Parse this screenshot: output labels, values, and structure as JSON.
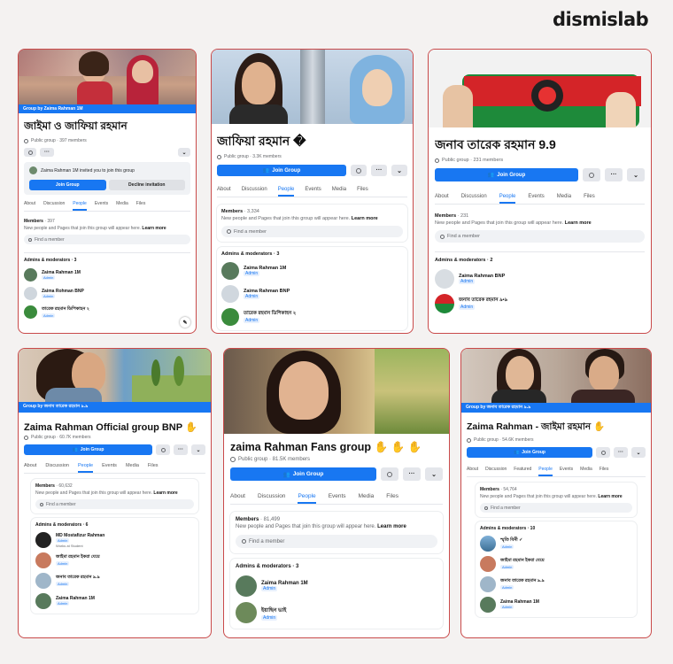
{
  "brand": "dismislab",
  "colors": {
    "accent": "#1877f2",
    "frame": "#c94a4a"
  },
  "cards": [
    {
      "group_by": "Group by Zaima Rahman 1M",
      "title": "জাইমা ও জাফিয়া রহমান",
      "meta": "Public group · 397 members",
      "invite": "Zaima Rahman 1M invited you to join this group",
      "join": "Join Group",
      "decline": "Decline invitation",
      "tabs": [
        "About",
        "Discussion",
        "People",
        "Events",
        "Media",
        "Files"
      ],
      "members_label": "Members",
      "members_count": "· 397",
      "members_note": "New people and Pages that join this group will appear here.",
      "learn_more": "Learn more",
      "search_placeholder": "Find a member",
      "admins_label": "Admins & moderators · 3",
      "admins": [
        {
          "name": "Zaima Rahman 1M",
          "badge": "Admin"
        },
        {
          "name": "Zaima Rohman BNP",
          "badge": "Admin"
        },
        {
          "name": "তারেক রহমান ডিপিকাহন ২",
          "badge": "Admin"
        }
      ]
    },
    {
      "title": "জাফিয়া রহমান �",
      "meta": "Public group · 3.3K members",
      "join": "Join Group",
      "tabs": [
        "About",
        "Discussion",
        "People",
        "Events",
        "Media",
        "Files"
      ],
      "members_label": "Members",
      "members_count": "· 3,334",
      "members_note": "New people and Pages that join this group will appear here.",
      "learn_more": "Learn more",
      "search_placeholder": "Find a member",
      "admins_label": "Admins & moderators · 3",
      "admins": [
        {
          "name": "Zaima Rahman 1M",
          "badge": "Admin"
        },
        {
          "name": "Zaima Rahman BNP",
          "badge": "Admin"
        },
        {
          "name": "তারেক রহমান ডিপিকাহন ২",
          "badge": "Admin"
        }
      ]
    },
    {
      "title": "জনাব তারেক রহমান 9.9",
      "meta": "Public group · 231 members",
      "join": "Join Group",
      "tabs": [
        "About",
        "Discussion",
        "People",
        "Events",
        "Media",
        "Files"
      ],
      "members_label": "Members",
      "members_count": "· 231",
      "members_note": "New people and Pages that join this group will appear here.",
      "learn_more": "Learn more",
      "search_placeholder": "Find a member",
      "admins_label": "Admins & moderators · 2",
      "admins": [
        {
          "name": "Zaima Rahman BNP",
          "badge": "Admin"
        },
        {
          "name": "জনাব তারেক রহমান ৯•৯",
          "badge": "Admin"
        }
      ]
    },
    {
      "group_by": "Group by জনাব তারেক রহমান ৯.৯",
      "title": "Zaima Rahman Official group BNP",
      "meta": "Public group · 60.7K members",
      "join": "Join Group",
      "tabs": [
        "About",
        "Discussion",
        "People",
        "Events",
        "Media",
        "Files"
      ],
      "members_label": "Members",
      "members_count": "· 60,632",
      "members_note": "New people and Pages that join this group will appear here.",
      "learn_more": "Learn more",
      "search_placeholder": "Find a member",
      "admins_label": "Admins & moderators · 6",
      "admins": [
        {
          "name": "MD Mostafizur Rahman",
          "badge": "Admin",
          "sub": "Works at Student"
        },
        {
          "name": "জাইমা রহমান ইকরা যেয়ে",
          "badge": "Admin"
        },
        {
          "name": "জনাব তারেক রহমান ৯.৯",
          "badge": "Admin"
        },
        {
          "name": "Zaima Rahman 1M",
          "badge": "Admin"
        }
      ]
    },
    {
      "title": "zaima Rahman Fans group",
      "meta": "Public group · 81.5K members",
      "join": "Join Group",
      "tabs": [
        "About",
        "Discussion",
        "People",
        "Events",
        "Media",
        "Files"
      ],
      "members_label": "Members",
      "members_count": "· 81,499",
      "members_note": "New people and Pages that join this group will appear here.",
      "learn_more": "Learn more",
      "search_placeholder": "Find a member",
      "admins_label": "Admins & moderators · 3",
      "admins": [
        {
          "name": "Zaima Rahman 1M",
          "badge": "Admin"
        },
        {
          "name": "ইয়াছিন ভাই",
          "badge": "Admin"
        }
      ]
    },
    {
      "group_by": "Group by জনাব তারেক রহমান ৯.৯",
      "title": "Zaima Rahman - জাইমা রহমান",
      "meta": "Public group · 54.6K members",
      "join": "Join Group",
      "tabs": [
        "About",
        "Discussion",
        "Featured",
        "People",
        "Events",
        "Media",
        "Files"
      ],
      "members_label": "Members",
      "members_count": "· 54,764",
      "members_note": "New people and Pages that join this group will appear here.",
      "learn_more": "Learn more",
      "search_placeholder": "Find a member",
      "admins_label": "Admins & moderators · 10",
      "admins": [
        {
          "name": "স্মৃতি বিনী ✓",
          "badge": "Admin"
        },
        {
          "name": "জাইমা রহমান ইকরা যেয়ে",
          "badge": "Admin"
        },
        {
          "name": "জনাব তারেক রহমান ৯.৯",
          "badge": "Admin"
        },
        {
          "name": "Zaima Rahman 1M",
          "badge": "Admin"
        }
      ]
    }
  ]
}
